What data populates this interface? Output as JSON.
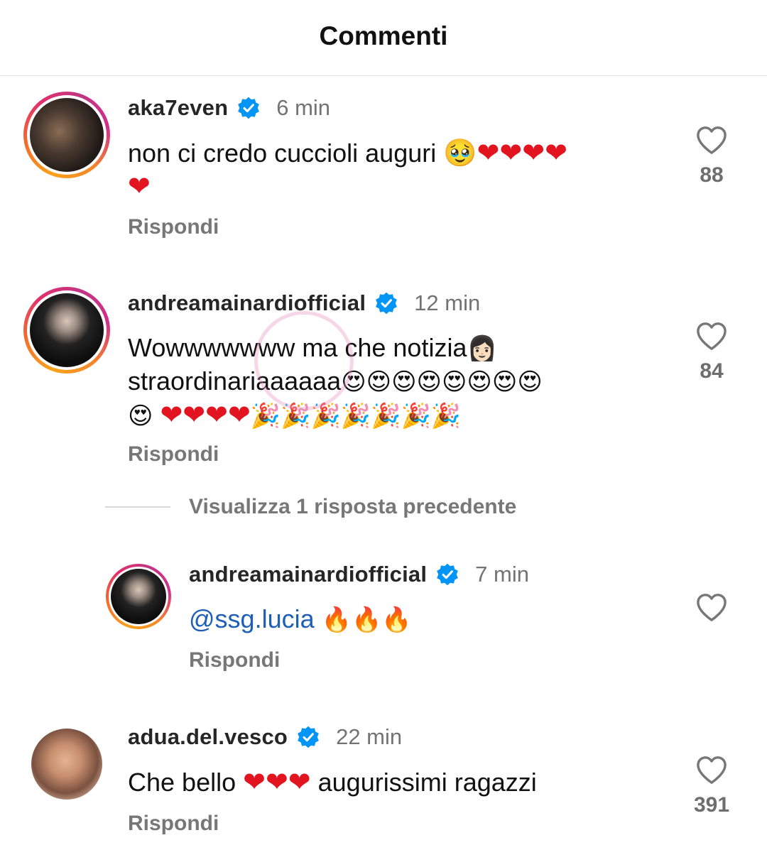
{
  "header": {
    "title": "Commenti"
  },
  "comments": [
    {
      "username": "aka7even",
      "time": "6 min",
      "text_line1": "non ci credo cuccioli auguri ",
      "line1_emojis": "🥹❤❤❤❤",
      "line2_emojis": "❤",
      "reply_label": "Rispondi",
      "likes": "88"
    },
    {
      "username": "andreamainardiofficial",
      "time": "12 min",
      "text_line1": "Wowwwwwww ma che notizia",
      "line1_emojis": "👩🏻",
      "text_line2": "straordinariaaaaaa",
      "line2_emojis": "😍😍😍😍😍😍😍😍",
      "line3_emojis_a": "😍",
      "line3_hearts": "❤❤❤❤",
      "line3_party": "🎉🎉🎉🎉🎉🎉🎉",
      "reply_label": "Rispondi",
      "likes": "84"
    },
    {
      "username": "andreamainardiofficial",
      "time": "7 min",
      "mention": "@ssg.lucia",
      "emojis": "🔥🔥🔥",
      "reply_label": "Rispondi"
    },
    {
      "username": "adua.del.vesco",
      "time": "22 min",
      "text_a": "Che bello ",
      "hearts": "❤❤❤",
      "text_b": " augurissimi ragazzi",
      "reply_label": "Rispondi",
      "likes": "391"
    }
  ],
  "view_previous": "Visualizza 1 risposta precedente",
  "colors": {
    "verified_blue": "#0095f6",
    "mention_blue": "#1d5fb8",
    "heart_red": "#e1141f",
    "muted_gray": "#777777"
  },
  "icons": [
    "verified-badge-icon",
    "heart-outline-icon"
  ]
}
